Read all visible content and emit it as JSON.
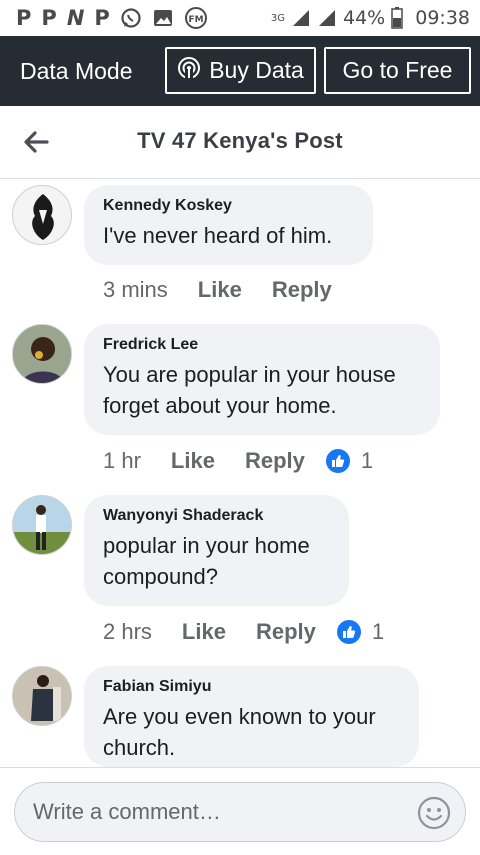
{
  "status_bar": {
    "left_glyphs": [
      "P",
      "P",
      "N",
      "P"
    ],
    "network": "3G",
    "battery": "44%",
    "time": "09:38"
  },
  "data_bar": {
    "mode_label": "Data Mode",
    "buy_label": "Buy Data",
    "free_label": "Go to Free",
    "background": "#262c33"
  },
  "header": {
    "title": "TV 47 Kenya's Post"
  },
  "comments": [
    {
      "author": "Kennedy Koskey",
      "text": "I've never heard of him.",
      "time": "3 mins",
      "like": "Like",
      "reply": "Reply",
      "reactions": null
    },
    {
      "author": "Fredrick Lee",
      "text": "You are popular in your house forget about your home.",
      "time": "1 hr",
      "like": "Like",
      "reply": "Reply",
      "reactions": "1"
    },
    {
      "author": "Wanyonyi Shaderack",
      "text": "popular in your home compound?",
      "time": "2 hrs",
      "like": "Like",
      "reply": "Reply",
      "reactions": "1"
    },
    {
      "author": "Fabian Simiyu",
      "text": "Are you even known to your church.",
      "time": "",
      "like": "",
      "reply": "",
      "reactions": null
    }
  ],
  "composer": {
    "placeholder": "Write a comment…"
  },
  "colors": {
    "accent": "#1877f2",
    "bubble": "#f0f2f5",
    "secondary_text": "#65676b"
  },
  "icons": [
    "back-arrow-icon",
    "broadcast-icon",
    "like-reaction-icon",
    "emoji-icon",
    "whatsapp-icon",
    "image-icon",
    "fm-radio-icon",
    "signal-icon",
    "battery-icon"
  ]
}
